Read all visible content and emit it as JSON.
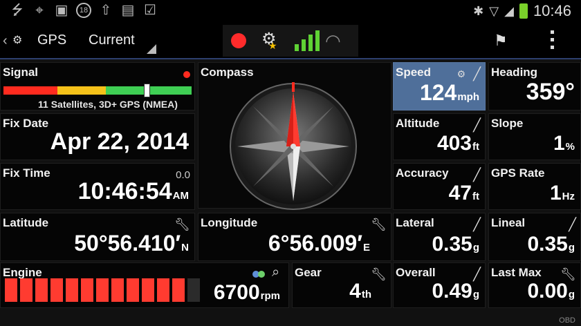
{
  "statusbar": {
    "time": "10:46",
    "notification_count": "18"
  },
  "actionbar": {
    "title": "GPS",
    "spinner_value": "Current"
  },
  "tiles": {
    "signal": {
      "label": "Signal",
      "text": "11 Satellites, 3D+ GPS (NMEA)",
      "level_fraction": 0.76
    },
    "compass": {
      "label": "Compass",
      "heading_deg": 359
    },
    "speed": {
      "label": "Speed",
      "value": "124",
      "unit": "mph"
    },
    "heading": {
      "label": "Heading",
      "value": "359°"
    },
    "fix_date": {
      "label": "Fix Date",
      "value": "Apr 22, 2014"
    },
    "altitude": {
      "label": "Altitude",
      "value": "403",
      "unit": "ft"
    },
    "slope": {
      "label": "Slope",
      "value": "1",
      "unit": "%"
    },
    "fix_time": {
      "label": "Fix Time",
      "value": "10:46:54",
      "unit": "AM",
      "extra": "0.0"
    },
    "accuracy": {
      "label": "Accuracy",
      "value": "47",
      "unit": "ft"
    },
    "gps_rate": {
      "label": "GPS Rate",
      "value": "1",
      "unit": "Hz"
    },
    "latitude": {
      "label": "Latitude",
      "value": "50°56.410′",
      "unit": "N"
    },
    "longitude": {
      "label": "Longitude",
      "value": "6°56.009′",
      "unit": "E"
    },
    "lateral": {
      "label": "Lateral",
      "value": "0.35",
      "unit": "g"
    },
    "lineal": {
      "label": "Lineal",
      "value": "0.35",
      "unit": "g"
    },
    "engine": {
      "label": "Engine",
      "value": "6700",
      "unit": "rpm",
      "level_bars_on": 12,
      "level_bars_total": 13
    },
    "gear": {
      "label": "Gear",
      "value": "4",
      "unit": "th"
    },
    "overall": {
      "label": "Overall",
      "value": "0.49",
      "unit": "g"
    },
    "last_max": {
      "label": "Last Max",
      "value": "0.00",
      "unit": "g"
    }
  },
  "footer": {
    "brand": "OBD"
  },
  "colors": {
    "accent": "#4f6f9a",
    "record": "#ff2b2b",
    "signal_red": "#ff2b1f",
    "signal_yellow": "#f5c21a",
    "signal_green": "#3fcf54",
    "engine_bar": "#ff3b30"
  },
  "icons": {
    "tool": "wrench-icon",
    "graph": "graph-icon",
    "gps": "gps-satellite-icon",
    "search": "search-icon"
  }
}
